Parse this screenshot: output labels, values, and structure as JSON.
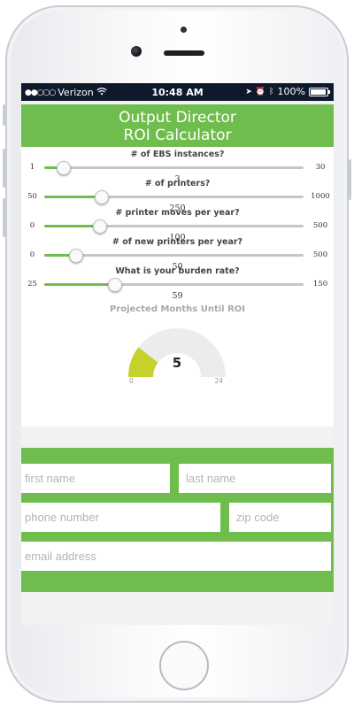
{
  "status_bar": {
    "carrier": "Verizon",
    "time": "10:48 AM",
    "battery": "100%"
  },
  "header": {
    "title_line1": "Output Director",
    "title_line2": "ROI Calculator"
  },
  "colors": {
    "accent": "#6fbd4c",
    "gauge_fill": "#c6d12b",
    "status_bar_bg": "#0e1a2b"
  },
  "sliders": [
    {
      "label": "# of EBS instances?",
      "min": "1",
      "max": "30",
      "value": "3",
      "fraction": 0.07
    },
    {
      "label": "# of printers?",
      "min": "50",
      "max": "1000",
      "value": "250",
      "fraction": 0.22
    },
    {
      "label": "# printer moves per year?",
      "min": "0",
      "max": "500",
      "value": "100",
      "fraction": 0.21
    },
    {
      "label": "# of new printers per year?",
      "min": "0",
      "max": "500",
      "value": "50",
      "fraction": 0.12
    },
    {
      "label": "What is your burden rate?",
      "min": "25",
      "max": "150",
      "value": "59",
      "fraction": 0.27
    }
  ],
  "roi": {
    "title": "Projected Months Until ROI",
    "value": "5",
    "min": "0",
    "max": "24",
    "fraction": 0.2083
  },
  "form": {
    "first_name_placeholder": "first name",
    "last_name_placeholder": "last name",
    "phone_placeholder": "phone number",
    "zip_placeholder": "zip code",
    "email_placeholder": "email address"
  }
}
